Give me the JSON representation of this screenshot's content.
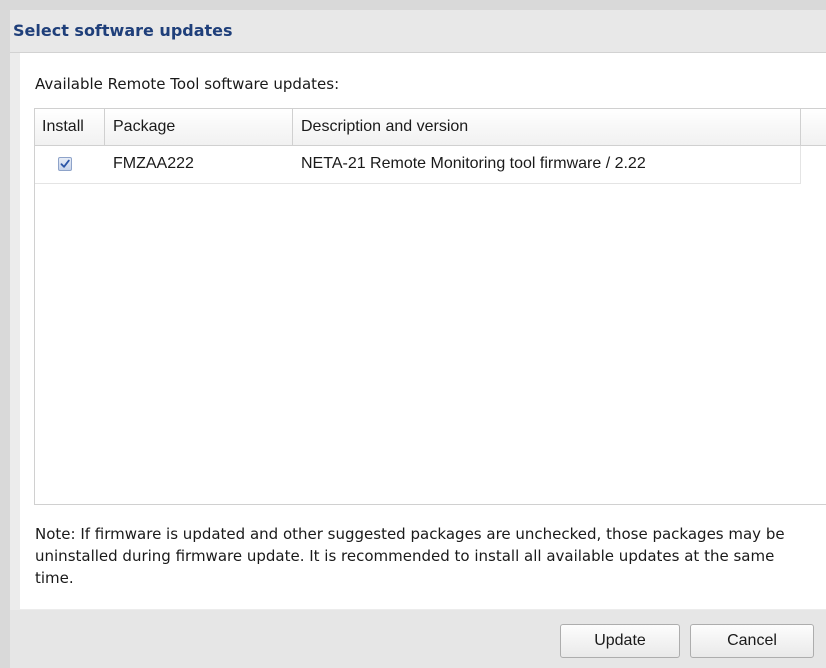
{
  "dialog": {
    "title": "Select software updates"
  },
  "content": {
    "subtitle": "Available Remote Tool software updates:",
    "table": {
      "columns": [
        "Install",
        "Package",
        "Description and version"
      ],
      "rows": [
        {
          "install": true,
          "package": "FMZAA222",
          "description": "NETA-21 Remote Monitoring tool firmware / 2.22"
        }
      ]
    },
    "note": "Note: If firmware is updated and other suggested packages are unchecked, those packages may be uninstalled during firmware update. It is recommended to install all available updates at the same time."
  },
  "footer": {
    "update_label": "Update",
    "cancel_label": "Cancel"
  },
  "colors": {
    "title": "#1f3f7a",
    "checkbox_check": "#2b55a6"
  },
  "icons": {
    "checkbox_checked": "checkmark-icon"
  }
}
